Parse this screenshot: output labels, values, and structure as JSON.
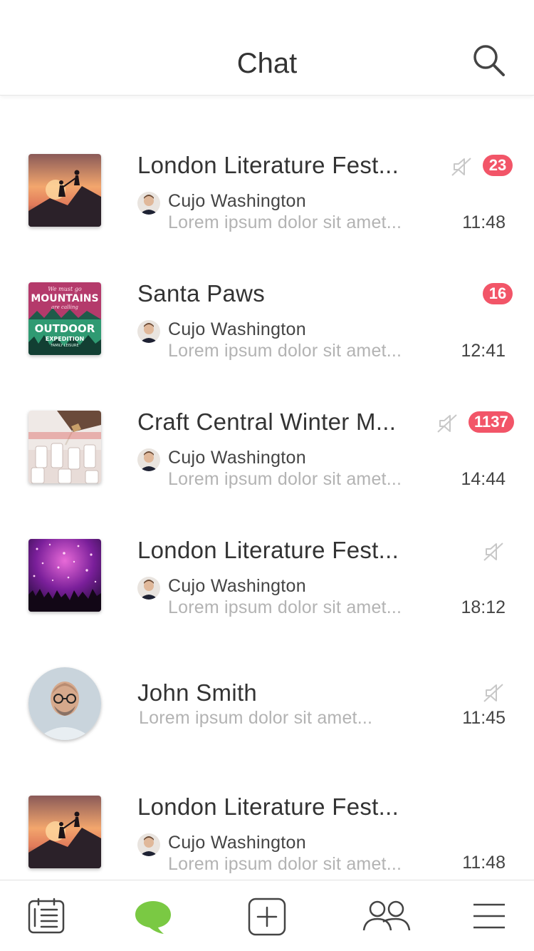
{
  "header": {
    "title": "Chat"
  },
  "chats": [
    {
      "title": "London Literature Fest...",
      "sender": "Cujo Washington",
      "preview": "Lorem ipsum dolor sit amet...",
      "time": "11:48",
      "badge": "23",
      "muted": true
    },
    {
      "title": "Santa Paws",
      "sender": "Cujo Washington",
      "preview": "Lorem ipsum dolor sit amet...",
      "time": "12:41",
      "badge": "16",
      "muted": false
    },
    {
      "title": "Craft Central Winter M...",
      "sender": "Cujo Washington",
      "preview": "Lorem ipsum dolor sit amet...",
      "time": "14:44",
      "badge": "1137",
      "muted": true
    },
    {
      "title": "London Literature Fest...",
      "sender": "Cujo Washington",
      "preview": "Lorem ipsum dolor sit amet...",
      "time": "18:12",
      "badge": "",
      "muted": true
    },
    {
      "title": "John Smith",
      "sender": "",
      "preview": "Lorem ipsum dolor sit amet...",
      "time": "11:45",
      "badge": "",
      "muted": true
    },
    {
      "title": "London Literature Fest...",
      "sender": "Cujo Washington",
      "preview": "Lorem ipsum dolor sit amet...",
      "time": "11:48",
      "badge": "",
      "muted": false
    }
  ],
  "thumb_text": {
    "mountains_top": "We must go",
    "mountains_word": "MOUNTAINS",
    "mountains_sub": "are calling",
    "outdoor_word": "OUTDOOR",
    "expedition_word": "EXPEDITION",
    "family_word": "FAMILY LEISURE"
  },
  "tabbar": {
    "items": [
      {
        "name": "notes",
        "icon": "notebook-icon"
      },
      {
        "name": "chat",
        "icon": "chat-bubble-icon",
        "active": true
      },
      {
        "name": "add",
        "icon": "plus-square-icon"
      },
      {
        "name": "contacts",
        "icon": "people-icon"
      },
      {
        "name": "menu",
        "icon": "hamburger-menu-icon"
      }
    ]
  },
  "colors": {
    "badge": "#f25568",
    "active_tab": "#7ac943",
    "text": "#333333",
    "muted_text": "#b3b3b3"
  }
}
